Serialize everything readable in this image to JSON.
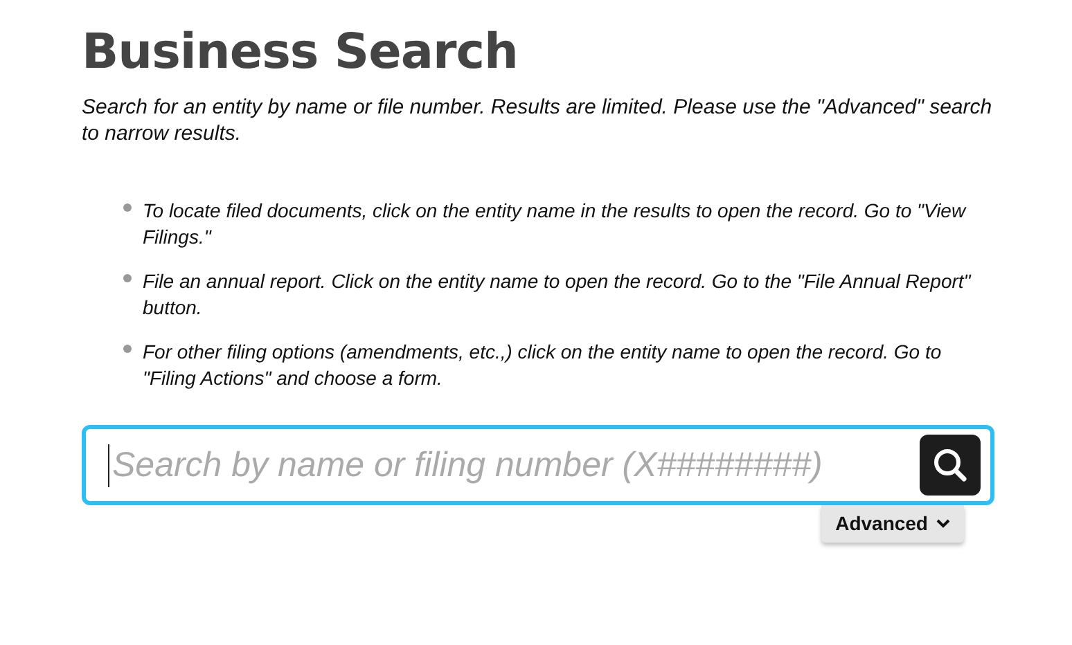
{
  "title": "Business Search",
  "intro": "Search for an entity by name or file number. Results are limited. Please use the \"Advanced\" search to narrow results.",
  "tips": [
    "To locate filed documents, click on the entity name in the results to open the record. Go to \"View Filings.\"",
    "File an annual report. Click on the entity name to open the record. Go to the \"File Annual Report\" button.",
    "For other filing options (amendments, etc.,) click on the entity name to open the record. Go to \"Filing Actions\" and choose a form."
  ],
  "search": {
    "placeholder": "Search by name or filing number (X########)",
    "focused": true
  },
  "advanced_button": {
    "label": "Advanced",
    "expanded": false
  }
}
